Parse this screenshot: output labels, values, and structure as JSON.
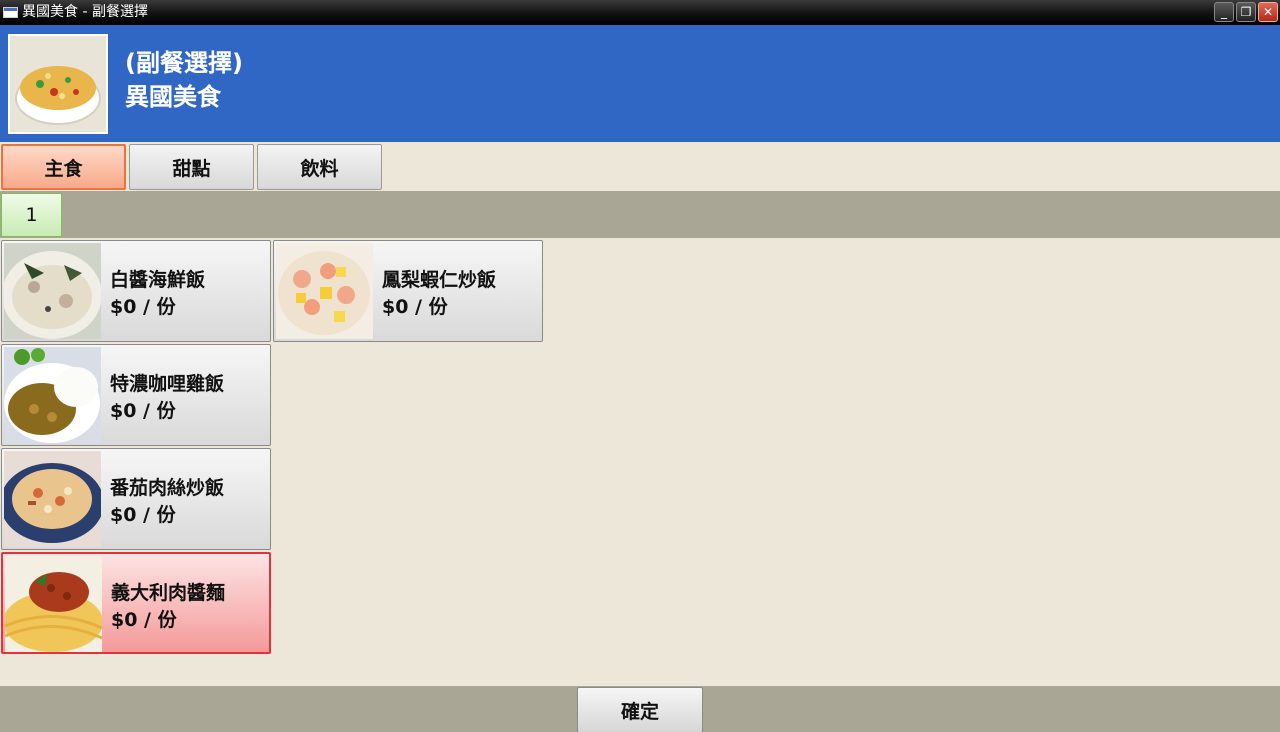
{
  "window": {
    "title": "異國美食 - 副餐選擇"
  },
  "header": {
    "subtitle": "(副餐選擇)",
    "name": "異國美食"
  },
  "tabs": [
    {
      "label": "主食",
      "active": true
    },
    {
      "label": "甜點",
      "active": false
    },
    {
      "label": "飲料",
      "active": false
    }
  ],
  "pagination": {
    "current": "1"
  },
  "items": [
    {
      "name": "白醬海鮮飯",
      "price": "$0 / 份",
      "selected": false,
      "image": "cream-seafood-rice-photo"
    },
    {
      "name": "鳳梨蝦仁炒飯",
      "price": "$0 / 份",
      "selected": false,
      "image": "pineapple-shrimp-fried-rice-photo"
    },
    {
      "name": "特濃咖哩雞飯",
      "price": "$0 / 份",
      "selected": false,
      "image": "curry-chicken-rice-photo"
    },
    {
      "name": "番茄肉絲炒飯",
      "price": "$0 / 份",
      "selected": false,
      "image": "tomato-pork-fried-rice-photo"
    },
    {
      "name": "義大利肉醬麵",
      "price": "$0 / 份",
      "selected": true,
      "image": "spaghetti-bolognese-photo"
    }
  ],
  "footer": {
    "confirm_label": "確定"
  },
  "colors": {
    "header_bg": "#3067C5",
    "body_bg": "#ECE7D8",
    "strip_bg": "#A9A696",
    "active_tab_border": "#e9743f",
    "selected_item_border": "#e0333c"
  }
}
